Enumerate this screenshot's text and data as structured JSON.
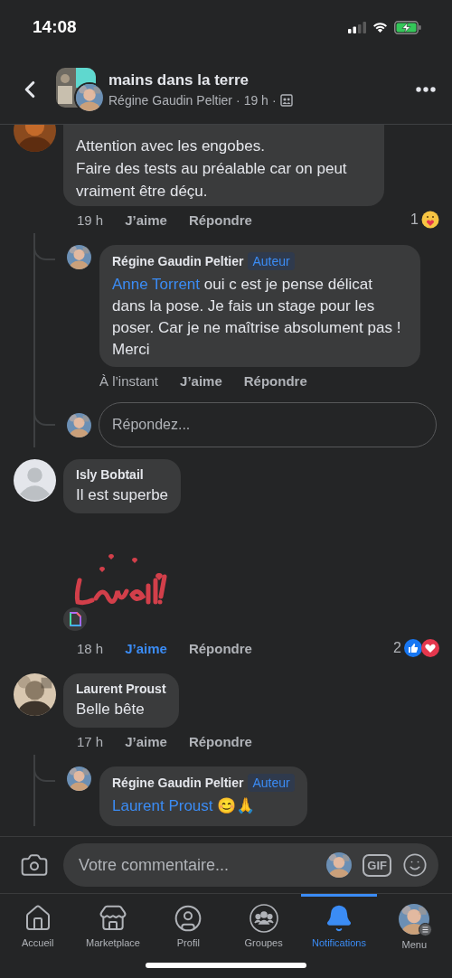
{
  "status_bar": {
    "time": "14:08"
  },
  "header": {
    "title": "mains dans la terre",
    "author": "Régine Gaudin Peltier",
    "separator": "·",
    "time": "19 h"
  },
  "comments": [
    {
      "kind": "text",
      "avatar": {
        "kind": "picture"
      },
      "text": "Attention avec les engobes.\nFaire des tests au préalable car on peut vraiment être déçu.",
      "time": "19 h",
      "like": "J’aime",
      "liked": false,
      "reply": "Répondre",
      "reaction_count": "1",
      "reactions": [
        {
          "kind": "care"
        }
      ],
      "replies": [
        {
          "author": "Régine Gaudin Peltier",
          "badge": "Auteur",
          "mention": "Anne Torrent",
          "text": " oui c est je pense délicat dans la pose. Je fais un stage pour les poser. Car je ne maîtrise absolument pas ! Merci",
          "time": "À l’instant",
          "like": "J’aime",
          "liked": false,
          "reply": "Répondre"
        }
      ],
      "reply_field": {
        "placeholder": "Répondez..."
      }
    },
    {
      "kind": "text",
      "avatar": {
        "kind": "silhouette"
      },
      "author": "Isly Bobtail",
      "text": "Il est superbe"
    },
    {
      "kind": "sticker",
      "time": "18 h",
      "like": "J’aime",
      "liked": true,
      "reply": "Répondre",
      "reaction_count": "2",
      "reactions": [
        {
          "kind": "like"
        },
        {
          "kind": "love"
        }
      ]
    },
    {
      "kind": "text",
      "avatar": {
        "kind": "picture"
      },
      "author": "Laurent Proust",
      "text": "Belle bête",
      "time": "17 h",
      "like": "J’aime",
      "liked": false,
      "reply": "Répondre",
      "replies": [
        {
          "author": "Régine Gaudin Peltier",
          "badge": "Auteur",
          "mention": "Laurent Proust",
          "text": " 😊🙏"
        }
      ]
    }
  ],
  "composer": {
    "placeholder": "Votre commentaire...",
    "gif": "GIF"
  },
  "tabs": [
    {
      "kind": "home",
      "label": "Accueil",
      "selected": false
    },
    {
      "kind": "store",
      "label": "Marketplace",
      "selected": false
    },
    {
      "kind": "profile",
      "label": "Profil",
      "selected": false
    },
    {
      "kind": "groups",
      "label": "Groupes",
      "selected": false
    },
    {
      "kind": "bell",
      "label": "Notifications",
      "selected": true
    },
    {
      "kind": "menu",
      "label": "Menu",
      "selected": false
    }
  ]
}
